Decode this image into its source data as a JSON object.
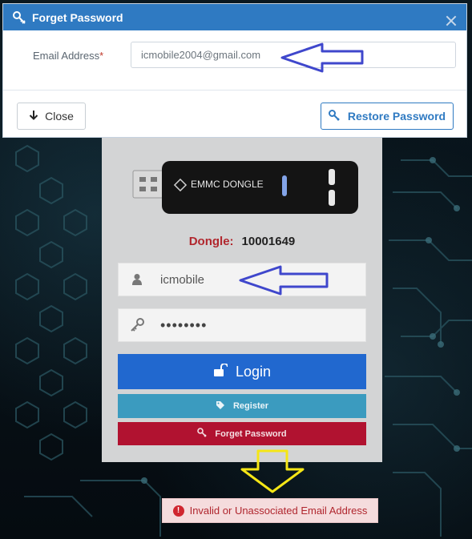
{
  "dialog": {
    "title": "Forget Password",
    "email_label": "Email Address",
    "email_required_mark": "*",
    "email_value": "icmobile2004@gmail.com",
    "close_label": "Close",
    "restore_label": "Restore Password"
  },
  "login": {
    "dongle_brand": "EMMC DONGLE",
    "dongle_label": "Dongle:",
    "dongle_value": "10001649",
    "username_value": "icmobile",
    "password_mask": "••••••••",
    "login_label": "Login",
    "register_label": "Register",
    "forget_label": "Forget Password"
  },
  "error": {
    "message": "Invalid or Unassociated Email Address",
    "icon_glyph": "!"
  },
  "colors": {
    "header_blue": "#2f7ac2",
    "login_blue": "#2168cf",
    "register_teal": "#3b9bbf",
    "forget_red": "#b11230",
    "dongle_label_red": "#b1272e",
    "annotation_arrow_blue": "#3f47cc",
    "annotation_arrow_yellow": "#f5e616"
  }
}
